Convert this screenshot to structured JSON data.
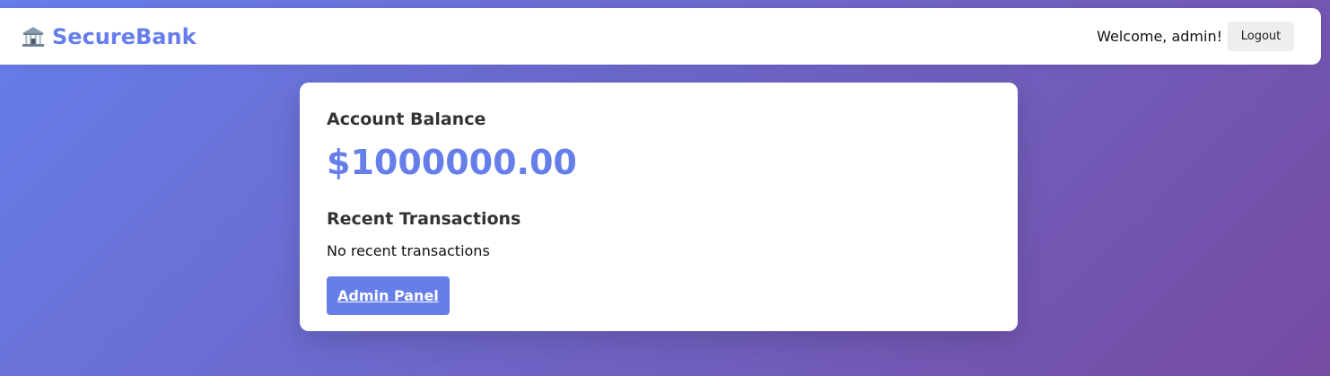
{
  "navbar": {
    "brand_name": "SecureBank",
    "brand_icon": "bank-building-icon",
    "welcome_text": "Welcome, admin!",
    "logout_label": "Logout"
  },
  "account": {
    "balance_heading": "Account Balance",
    "balance_amount": "$1000000.00",
    "transactions_heading": "Recent Transactions",
    "transactions_empty_text": "No recent transactions",
    "admin_panel_label": "Admin Panel"
  },
  "colors": {
    "accent": "#667eea",
    "gradient_start": "#667eea",
    "gradient_end": "#764ba2",
    "card_background": "#ffffff",
    "logout_button_background": "#eeeeee"
  }
}
